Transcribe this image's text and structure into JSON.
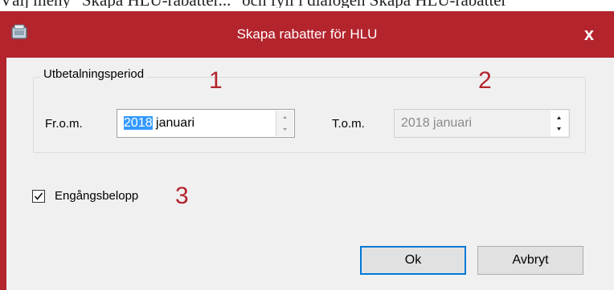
{
  "caption_text": "Välj meny \"Skapa HLU-rabatter...\" och fyll i dialogen Skapa HLU-rabatter",
  "window": {
    "title": "Skapa rabatter för HLU",
    "close_glyph": "x",
    "accent_color": "#b3242d"
  },
  "period": {
    "group_label": "Utbetalningsperiod",
    "from_label": "Fr.o.m.",
    "from_year": "2018",
    "from_month": "januari",
    "to_label": "T.o.m.",
    "to_value": "2018 januari",
    "to_disabled": true
  },
  "options": {
    "one_time_label": "Engångsbelopp",
    "one_time_checked": true
  },
  "markers": {
    "one": "1",
    "two": "2",
    "three": "3"
  },
  "buttons": {
    "ok_label": "Ok",
    "cancel_label": "Avbryt"
  },
  "icons": {
    "app": "app-icon",
    "close": "close-icon",
    "spin_up": "chevron-up-icon",
    "spin_down": "chevron-down-icon",
    "check": "checkmark-icon"
  }
}
